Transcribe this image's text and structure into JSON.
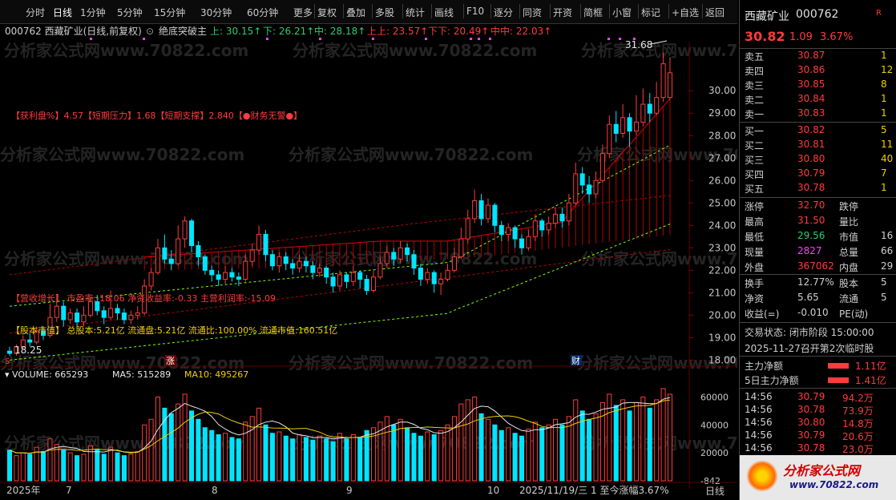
{
  "toolbar": {
    "left_items": [
      "分时",
      "日线",
      "1分钟",
      "5分钟",
      "15分钟",
      "30分钟",
      "60分钟",
      "更多"
    ],
    "right_items": [
      "复权",
      "叠加",
      "多股",
      "统计",
      "画线",
      "F10",
      "逐分",
      "同资",
      "开资",
      "简框",
      "小窗",
      "标记",
      "+自选",
      "返回"
    ],
    "active": "日线"
  },
  "chart_header": {
    "code_name": "000762 西藏矿业(日线,前复权)",
    "indicator": "绝底突破主",
    "values": [
      {
        "label": "上:",
        "value": "30.15",
        "color": "#2ecc71"
      },
      {
        "label": "下:",
        "value": "26.21",
        "color": "#2ecc71"
      },
      {
        "label": "中:",
        "value": "28.18",
        "color": "#2ecc71"
      },
      {
        "label": "上上:",
        "value": "23.57",
        "color": "#ff3b3b"
      },
      {
        "label": "下下:",
        "value": "20.49",
        "color": "#ff3b3b"
      },
      {
        "label": "中中:",
        "value": "22.03",
        "color": "#ff3b3b"
      }
    ]
  },
  "annotations": {
    "profit_line": "【获利盘%】4.57【短期压力】1.68【短期支撑】2.840【●财务无警●】",
    "ops_line": "【营收增长】 市盈率:-18.06 净资收益率:-0.33 主营利润率:-15.09",
    "capital_line": "【股本市值】 总股本:5.21亿 流通盘:5.21亿 流通比:100.00% 流通市值:160.51亿",
    "high_label": "31.68",
    "low_label": "18.25",
    "zhang_mark": "涨",
    "cai_mark": "财",
    "s_mark": "S"
  },
  "price_axis": [
    "30.00",
    "29.00",
    "28.00",
    "27.00",
    "26.00",
    "25.00",
    "24.00",
    "23.00",
    "22.00",
    "21.00",
    "20.00",
    "19.00",
    "18.00"
  ],
  "volume_header": {
    "volume": "VOLUME: 665293",
    "ma5": "MA5: 515289",
    "ma10": "MA10: 495267"
  },
  "volume_axis": [
    "60000",
    "40000",
    "20000",
    "-842"
  ],
  "date_axis": [
    {
      "label": "2025年"
    },
    {
      "label": "7"
    },
    {
      "label": "8"
    },
    {
      "label": "9"
    },
    {
      "label": "10"
    },
    {
      "label": "2025/11/19/三 1 至今涨幅3.67%"
    }
  ],
  "period_label": "日线",
  "side": {
    "title": "西藏矿业",
    "code": "000762",
    "price": "30.82",
    "change": "1.09",
    "pct": "3.67%",
    "asks": [
      {
        "label": "卖五",
        "price": "30.87",
        "vol": "1"
      },
      {
        "label": "卖四",
        "price": "30.86",
        "vol": "12"
      },
      {
        "label": "卖三",
        "price": "30.85",
        "vol": "8"
      },
      {
        "label": "卖二",
        "price": "30.84",
        "vol": "1"
      },
      {
        "label": "卖一",
        "price": "30.83",
        "vol": "1"
      }
    ],
    "bids": [
      {
        "label": "买一",
        "price": "30.82",
        "vol": "5"
      },
      {
        "label": "买二",
        "price": "30.81",
        "vol": "11"
      },
      {
        "label": "买三",
        "price": "30.80",
        "vol": "40"
      },
      {
        "label": "买四",
        "price": "30.79",
        "vol": "7"
      },
      {
        "label": "买五",
        "price": "30.78",
        "vol": "1"
      }
    ],
    "stats": [
      {
        "l1": "涨停",
        "v1": "32.70",
        "c1": "#ff3b3b",
        "l2": "跌停",
        "v2": ""
      },
      {
        "l1": "最高",
        "v1": "31.50",
        "c1": "#ff3b3b",
        "l2": "量比",
        "v2": ""
      },
      {
        "l1": "最低",
        "v1": "29.56",
        "c1": "#2ecc71",
        "l2": "市值",
        "v2": "16"
      },
      {
        "l1": "现量",
        "v1": "2827",
        "c1": "#ff40ff",
        "l2": "总量",
        "v2": "66"
      },
      {
        "l1": "外盘",
        "v1": "367062",
        "c1": "#ff3b3b",
        "l2": "内盘",
        "v2": "29"
      }
    ],
    "stats2": [
      {
        "l1": "换手",
        "v1": "12.77%",
        "l2": "股本",
        "v2": "5"
      },
      {
        "l1": "净资",
        "v1": "5.65",
        "l2": "流通",
        "v2": "5"
      },
      {
        "l1": "收益(=)",
        "v1": "-0.010",
        "l2": "PE(动)",
        "v2": ""
      }
    ],
    "status": "交易状态: 闭市阶段 15:00:00",
    "news": "2025-11-27召开第2次临时股",
    "flows": [
      {
        "label": "主力净额",
        "value": "1.11亿"
      },
      {
        "label": "5日主力净额",
        "value": "1.41亿"
      }
    ],
    "ticks": [
      {
        "time": "14:56",
        "price": "30.79",
        "vol": "94.2万"
      },
      {
        "time": "14:56",
        "price": "30.78",
        "vol": "73.9万"
      },
      {
        "time": "14:56",
        "price": "30.80",
        "vol": "14.8万"
      },
      {
        "time": "14:56",
        "price": "30.79",
        "vol": "20.6万"
      },
      {
        "time": "14:56",
        "price": "30.78",
        "vol": "23.0万"
      }
    ],
    "logo_text": "分析家公式网",
    "logo_url": "www.70822.com"
  },
  "watermark": "分析家公式网www.70822.com",
  "chart_data": {
    "type": "candlestick",
    "ylim": [
      17.8,
      31.9
    ],
    "candles": [
      [
        18.4,
        18.3,
        18.6,
        18.2
      ],
      [
        18.3,
        18.6,
        18.7,
        18.2
      ],
      [
        18.6,
        18.9,
        19.1,
        18.5
      ],
      [
        18.9,
        18.8,
        19.2,
        18.6
      ],
      [
        18.8,
        19.3,
        19.5,
        18.7
      ],
      [
        19.3,
        19.1,
        19.5,
        18.9
      ],
      [
        19.1,
        19.9,
        20.5,
        19.0
      ],
      [
        19.9,
        20.4,
        20.9,
        19.7
      ],
      [
        20.4,
        19.8,
        20.6,
        19.5
      ],
      [
        19.8,
        20.1,
        20.3,
        19.6
      ],
      [
        20.1,
        19.7,
        20.3,
        19.4
      ],
      [
        19.7,
        20.0,
        20.4,
        19.5
      ],
      [
        20.0,
        20.6,
        20.8,
        19.9
      ],
      [
        20.6,
        20.2,
        20.9,
        20.0
      ],
      [
        20.2,
        19.9,
        20.4,
        19.6
      ],
      [
        19.9,
        20.3,
        21.1,
        19.8
      ],
      [
        20.3,
        20.1,
        20.5,
        19.8
      ],
      [
        20.1,
        19.8,
        20.3,
        19.6
      ],
      [
        19.8,
        20.0,
        20.2,
        19.6
      ],
      [
        20.0,
        20.1,
        20.4,
        19.8
      ],
      [
        20.1,
        21.3,
        21.6,
        20.0
      ],
      [
        21.3,
        21.9,
        22.1,
        21.1
      ],
      [
        21.9,
        23.0,
        23.4,
        21.8
      ],
      [
        23.0,
        22.5,
        23.6,
        22.3
      ],
      [
        22.5,
        22.3,
        22.9,
        22.0
      ],
      [
        22.3,
        23.4,
        24.0,
        22.2
      ],
      [
        23.4,
        24.2,
        24.4,
        23.0
      ],
      [
        24.2,
        23.1,
        24.3,
        22.8
      ],
      [
        23.1,
        22.6,
        23.3,
        22.2
      ],
      [
        22.6,
        22.0,
        22.7,
        21.8
      ],
      [
        22.0,
        21.8,
        22.2,
        21.5
      ],
      [
        21.8,
        21.6,
        22.0,
        21.3
      ],
      [
        21.6,
        21.9,
        22.2,
        21.4
      ],
      [
        21.9,
        21.7,
        22.1,
        21.5
      ],
      [
        21.7,
        21.6,
        21.9,
        21.3
      ],
      [
        21.6,
        22.4,
        22.7,
        21.5
      ],
      [
        22.4,
        22.9,
        23.2,
        22.2
      ],
      [
        22.9,
        23.6,
        24.0,
        22.7
      ],
      [
        23.6,
        22.7,
        23.8,
        22.4
      ],
      [
        22.7,
        22.2,
        22.9,
        22.0
      ],
      [
        22.2,
        22.6,
        22.8,
        21.9
      ],
      [
        22.6,
        22.3,
        22.8,
        22.0
      ],
      [
        22.3,
        22.1,
        22.5,
        21.8
      ],
      [
        22.1,
        22.4,
        22.7,
        21.9
      ],
      [
        22.4,
        22.2,
        22.6,
        21.9
      ],
      [
        22.2,
        21.9,
        22.4,
        21.6
      ],
      [
        21.9,
        22.1,
        22.3,
        21.7
      ],
      [
        22.1,
        21.7,
        22.2,
        21.4
      ],
      [
        21.7,
        21.3,
        21.9,
        21.0
      ],
      [
        21.3,
        21.8,
        22.0,
        21.1
      ],
      [
        21.8,
        21.5,
        21.9,
        21.2
      ],
      [
        21.5,
        21.9,
        22.2,
        21.3
      ],
      [
        21.9,
        21.6,
        22.0,
        21.2
      ],
      [
        21.6,
        21.1,
        21.8,
        20.9
      ],
      [
        21.1,
        21.7,
        22.0,
        21.0
      ],
      [
        21.7,
        22.3,
        22.6,
        21.6
      ],
      [
        22.3,
        22.8,
        23.1,
        22.1
      ],
      [
        22.8,
        22.5,
        23.0,
        22.2
      ],
      [
        22.5,
        23.0,
        23.3,
        22.3
      ],
      [
        23.0,
        22.7,
        23.2,
        22.4
      ],
      [
        22.7,
        22.1,
        22.9,
        21.8
      ],
      [
        22.1,
        21.6,
        22.3,
        21.3
      ],
      [
        21.6,
        21.9,
        22.1,
        21.4
      ],
      [
        21.9,
        21.4,
        22.0,
        21.0
      ],
      [
        21.4,
        21.6,
        21.9,
        20.9
      ],
      [
        21.6,
        22.0,
        22.3,
        21.5
      ],
      [
        22.0,
        22.6,
        23.0,
        21.9
      ],
      [
        22.6,
        23.4,
        23.9,
        22.5
      ],
      [
        23.4,
        24.3,
        24.7,
        23.2
      ],
      [
        24.3,
        25.1,
        25.6,
        24.1
      ],
      [
        25.1,
        24.3,
        25.4,
        24.0
      ],
      [
        24.3,
        24.9,
        25.2,
        24.1
      ],
      [
        24.9,
        24.0,
        25.0,
        23.7
      ],
      [
        24.0,
        23.6,
        24.2,
        23.3
      ],
      [
        23.6,
        23.9,
        24.1,
        23.3
      ],
      [
        23.9,
        23.4,
        24.0,
        23.0
      ],
      [
        23.4,
        23.0,
        23.6,
        22.7
      ],
      [
        23.0,
        23.5,
        23.8,
        22.9
      ],
      [
        23.5,
        24.2,
        24.5,
        23.3
      ],
      [
        24.2,
        23.8,
        24.3,
        23.5
      ],
      [
        23.8,
        24.1,
        24.4,
        23.6
      ],
      [
        24.1,
        24.5,
        24.8,
        23.9
      ],
      [
        24.5,
        24.2,
        24.8,
        23.9
      ],
      [
        24.2,
        25.0,
        25.4,
        24.0
      ],
      [
        25.0,
        26.3,
        26.8,
        24.9
      ],
      [
        26.3,
        25.8,
        26.6,
        25.4
      ],
      [
        25.8,
        25.4,
        26.2,
        25.0
      ],
      [
        25.4,
        26.0,
        26.4,
        25.2
      ],
      [
        26.0,
        27.2,
        27.6,
        25.9
      ],
      [
        27.2,
        28.5,
        28.9,
        27.0
      ],
      [
        28.5,
        28.1,
        29.1,
        27.7
      ],
      [
        28.1,
        28.8,
        29.4,
        27.9
      ],
      [
        28.8,
        28.2,
        29.0,
        27.5
      ],
      [
        28.2,
        28.6,
        29.8,
        28.0
      ],
      [
        28.6,
        29.4,
        30.1,
        28.4
      ],
      [
        29.4,
        29.0,
        29.9,
        28.6
      ],
      [
        29.0,
        29.7,
        30.4,
        28.9
      ],
      [
        29.7,
        31.2,
        31.7,
        29.5
      ],
      [
        29.7,
        30.8,
        31.5,
        29.6
      ]
    ],
    "volumes": [
      22,
      18,
      20,
      19,
      24,
      21,
      30,
      26,
      22,
      20,
      18,
      19,
      25,
      22,
      19,
      24,
      20,
      18,
      19,
      21,
      40,
      44,
      60,
      52,
      48,
      55,
      62,
      50,
      44,
      38,
      36,
      33,
      34,
      31,
      30,
      42,
      46,
      52,
      40,
      34,
      35,
      32,
      30,
      33,
      31,
      29,
      32,
      30,
      28,
      34,
      30,
      33,
      31,
      36,
      38,
      42,
      46,
      40,
      44,
      38,
      34,
      32,
      35,
      33,
      36,
      40,
      46,
      55,
      58,
      60,
      48,
      44,
      40,
      36,
      38,
      34,
      32,
      37,
      42,
      38,
      40,
      44,
      40,
      46,
      58,
      50,
      44,
      48,
      56,
      62,
      54,
      58,
      50,
      56,
      60,
      52,
      58,
      66,
      62
    ]
  }
}
